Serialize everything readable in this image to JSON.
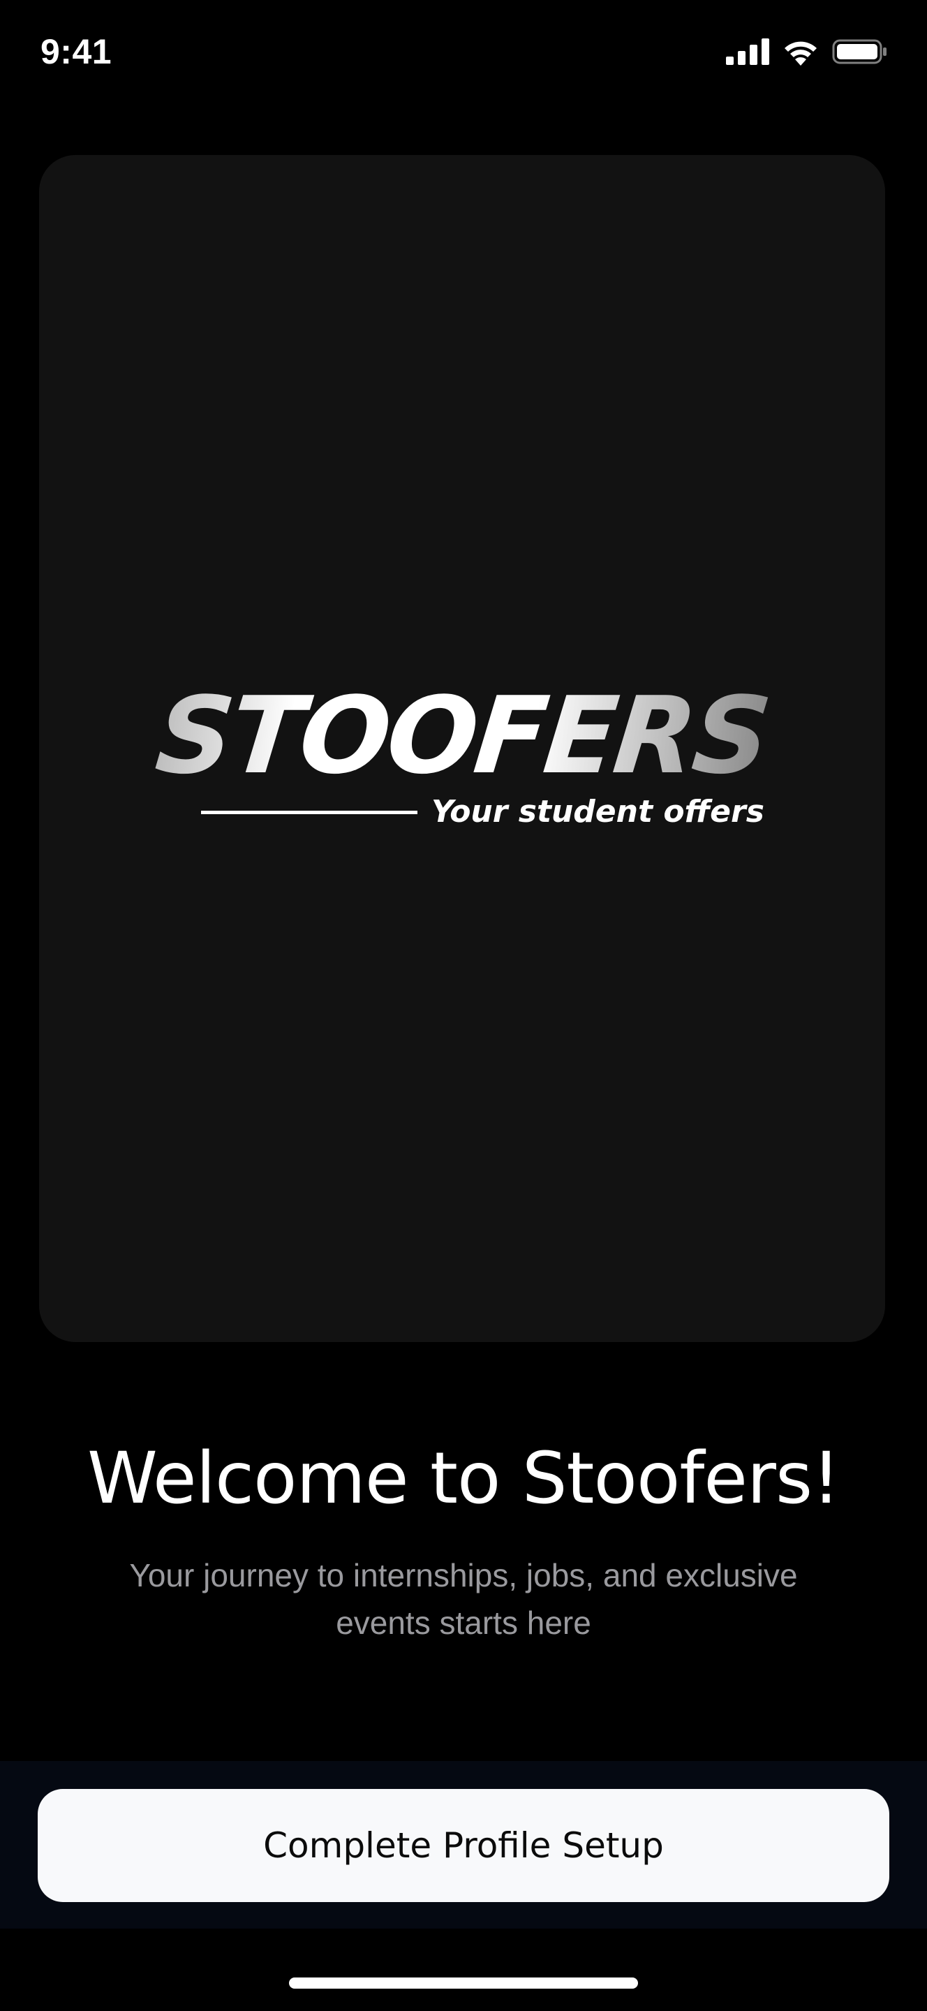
{
  "status_bar": {
    "time": "9:41",
    "icons": [
      "cellular-signal-icon",
      "wifi-icon",
      "battery-icon"
    ]
  },
  "hero": {
    "logo_text": "STOOFERS",
    "tagline": "Your student offers"
  },
  "welcome": {
    "title": "Welcome to Stoofers!",
    "subtitle": "Your journey to internships, jobs, and exclusive events starts here"
  },
  "actions": {
    "primary_label": "Complete Profile Setup"
  },
  "colors": {
    "background": "#000000",
    "card": "#121212",
    "subtitle_text": "#9a9a9e",
    "button_bg": "#f8f9fb",
    "button_text": "#0b0b0b"
  }
}
